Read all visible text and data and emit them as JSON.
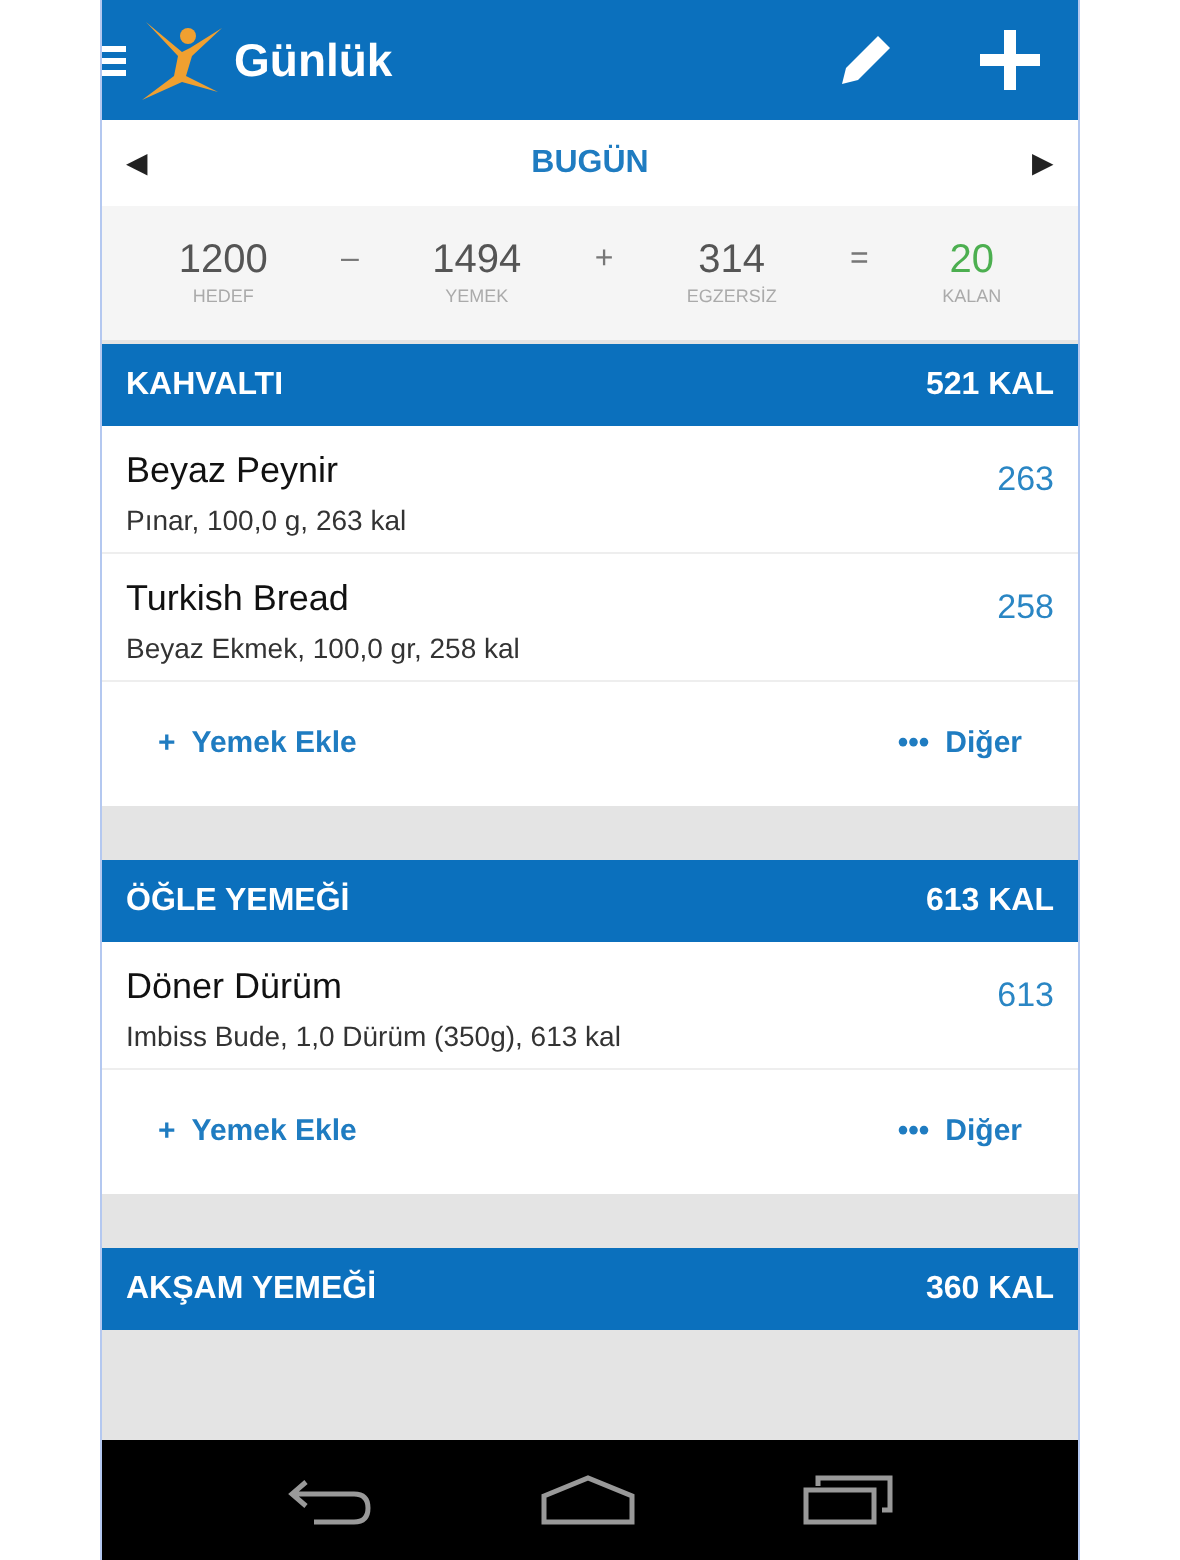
{
  "app_bar": {
    "title": "Günlük"
  },
  "date_nav": {
    "prev": "◀",
    "label": "BUGÜN",
    "next": "▶"
  },
  "summary": [
    {
      "kind": "term",
      "value": "1200",
      "label": "HEDEF"
    },
    {
      "kind": "operator",
      "symbol": "–"
    },
    {
      "kind": "term",
      "value": "1494",
      "label": "YEMEK"
    },
    {
      "kind": "operator",
      "symbol": "+"
    },
    {
      "kind": "term",
      "value": "314",
      "label": "EGZERSİZ"
    },
    {
      "kind": "operator",
      "symbol": "="
    },
    {
      "kind": "result",
      "value": "20",
      "label": "KALAN"
    }
  ],
  "meals": [
    {
      "title": "KAHVALTI",
      "total": "521 KAL",
      "entries": [
        {
          "name": "Beyaz Peynir",
          "detail": "Pınar, 100,0 g, 263 kal",
          "calories": "263"
        },
        {
          "name": "Turkish Bread",
          "detail": "Beyaz Ekmek, 100,0 gr, 258 kal",
          "calories": "258"
        }
      ],
      "actions": {
        "add_icon": "+",
        "add": "Yemek Ekle",
        "more_icon": "•••",
        "more": "Diğer"
      }
    },
    {
      "title": "ÖĞLE YEMEĞİ",
      "total": "613 KAL",
      "entries": [
        {
          "name": "Döner Dürüm",
          "detail": "Imbiss Bude, 1,0 Dürüm (350g), 613 kal",
          "calories": "613"
        }
      ],
      "actions": {
        "add_icon": "+",
        "add": "Yemek Ekle",
        "more_icon": "•••",
        "more": "Diğer"
      }
    },
    {
      "title": "AKŞAM YEMEĞİ",
      "total": "360 KAL"
    }
  ]
}
